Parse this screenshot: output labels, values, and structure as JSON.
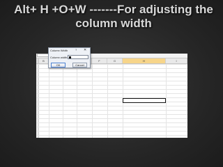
{
  "slide": {
    "title": "Alt+ H +O+W -------For adjusting the column width"
  },
  "sheet": {
    "name_box_dropdown": "▾",
    "fx_label": "fx",
    "columns": [
      "B",
      "C",
      "D",
      "E",
      "F",
      "G",
      "H",
      "I"
    ],
    "selected_column": "H"
  },
  "dialog": {
    "title": "Column Width",
    "help": "?",
    "close": "✕",
    "field_label": "Column width:",
    "field_value": "",
    "ok_label": "OK",
    "cancel_label": "Cancel"
  }
}
